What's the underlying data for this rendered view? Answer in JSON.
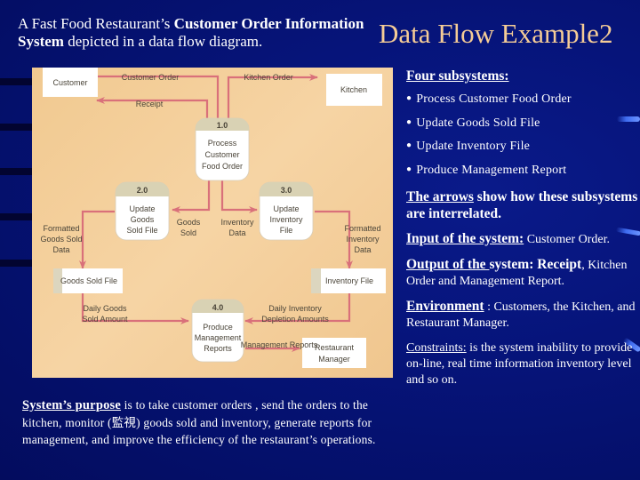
{
  "headline": {
    "part1": "A Fast Food Restaurant’s ",
    "part2_bold": "Customer Order Information System",
    "part3": " depicted in a data flow diagram."
  },
  "slide_title": "Data Flow Example2",
  "diagram": {
    "external_entities": {
      "customer": "Customer",
      "kitchen": "Kitchen",
      "restaurant_manager_line1": "Restaurant",
      "restaurant_manager_line2": "Manager"
    },
    "processes": [
      {
        "id": "1.0",
        "lines": [
          "Process",
          "Customer",
          "Food Order"
        ]
      },
      {
        "id": "2.0",
        "lines": [
          "Update",
          "Goods",
          "Sold File"
        ]
      },
      {
        "id": "3.0",
        "lines": [
          "Update",
          "Inventory",
          "File"
        ]
      },
      {
        "id": "4.0",
        "lines": [
          "Produce",
          "Management",
          "Reports"
        ]
      }
    ],
    "data_stores": {
      "goods_sold_file": "Goods Sold File",
      "inventory_file": "Inventory File"
    },
    "flows": {
      "customer_order": "Customer Order",
      "receipt": "Receipt",
      "kitchen_order": "Kitchen Order",
      "goods_sold": [
        "Goods",
        "Sold"
      ],
      "inventory_data": [
        "Inventory",
        "Data"
      ],
      "formatted_goods_sold_data": [
        "Formatted",
        "Goods Sold",
        "Data"
      ],
      "formatted_inventory_data": [
        "Formatted",
        "Inventory",
        "Data"
      ],
      "daily_goods_sold_amount": [
        "Daily Goods",
        "Sold Amount"
      ],
      "daily_inventory_depletion": [
        "Daily Inventory",
        "Depletion Amounts"
      ],
      "management_reports": "Management Reports"
    }
  },
  "purpose": {
    "lead": "System’s purpose",
    "text": " is to take customer orders , send the orders to the kitchen, monitor (監視) goods sold and inventory, generate reports for management, and improve the efficiency of the restaurant’s operations."
  },
  "right_column": {
    "subsystems_heading": "Four subsystems:",
    "subsystems": [
      "Process Customer Food Order",
      "Update Goods Sold File",
      "Update Inventory File",
      "Produce Management Report"
    ],
    "arrows_lead": "The arrows",
    "arrows_text": " show how these subsystems are interrelated.",
    "input_lead": "Input of the system:",
    "input_text": " Customer Order.",
    "output_lead": "Output of the ",
    "output_bold": "system: Receipt",
    "output_text": ", Kitchen Order and Management Report.",
    "environment_lead": "Environment",
    "environment_text": " : Customers, the Kitchen, and Restaurant Manager.",
    "constraints_lead": "Constraints:",
    "constraints_text": " is the system inability to provide on-line, real time information inventory level and so on."
  },
  "colors": {
    "background": "#06147a",
    "title": "#f5cc96",
    "panel": "#f3cd98",
    "arrow": "#d9707a"
  }
}
